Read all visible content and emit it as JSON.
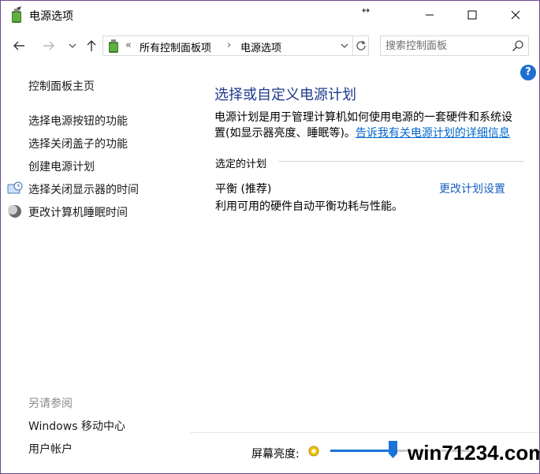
{
  "window": {
    "title": "电源选项",
    "resize_glyph": "↔"
  },
  "address_bar": {
    "overflow": "«",
    "segments": [
      "所有控制面板项",
      "电源选项"
    ],
    "separator": "›"
  },
  "search": {
    "placeholder": "搜索控制面板"
  },
  "sidebar": {
    "home": "控制面板主页",
    "items": [
      {
        "label": "选择电源按钮的功能",
        "icon": ""
      },
      {
        "label": "选择关闭盖子的功能",
        "icon": ""
      },
      {
        "label": "创建电源计划",
        "icon": ""
      },
      {
        "label": "选择关闭显示器的时间",
        "icon": "monitor-clock-icon"
      },
      {
        "label": "更改计算机睡眠时间",
        "icon": "moon-icon"
      }
    ],
    "see_also_title": "另请参阅",
    "see_also": [
      "Windows 移动中心",
      "用户帐户"
    ]
  },
  "main": {
    "title": "选择或自定义电源计划",
    "desc_line1": "电源计划是用于管理计算机如何使用电源的一套硬件和系统设",
    "desc_line2_prefix": "置(如显示器亮度、睡眠等)。",
    "desc_link": "告诉我有关电源计划的详细信息",
    "section_label": "选定的计划",
    "plan_name": "平衡 (推荐)",
    "plan_change_link": "更改计划设置",
    "plan_desc": "利用可用的硬件自动平衡功耗与性能。",
    "help_glyph": "?"
  },
  "brightness": {
    "label": "屏幕亮度:",
    "value_fraction": 0.44
  },
  "watermark": "win71234.com",
  "colors": {
    "accent": "#1a73d9",
    "link": "#0066cc",
    "title_blue": "#1e3a8c",
    "window_border": "#6d4a8f"
  }
}
